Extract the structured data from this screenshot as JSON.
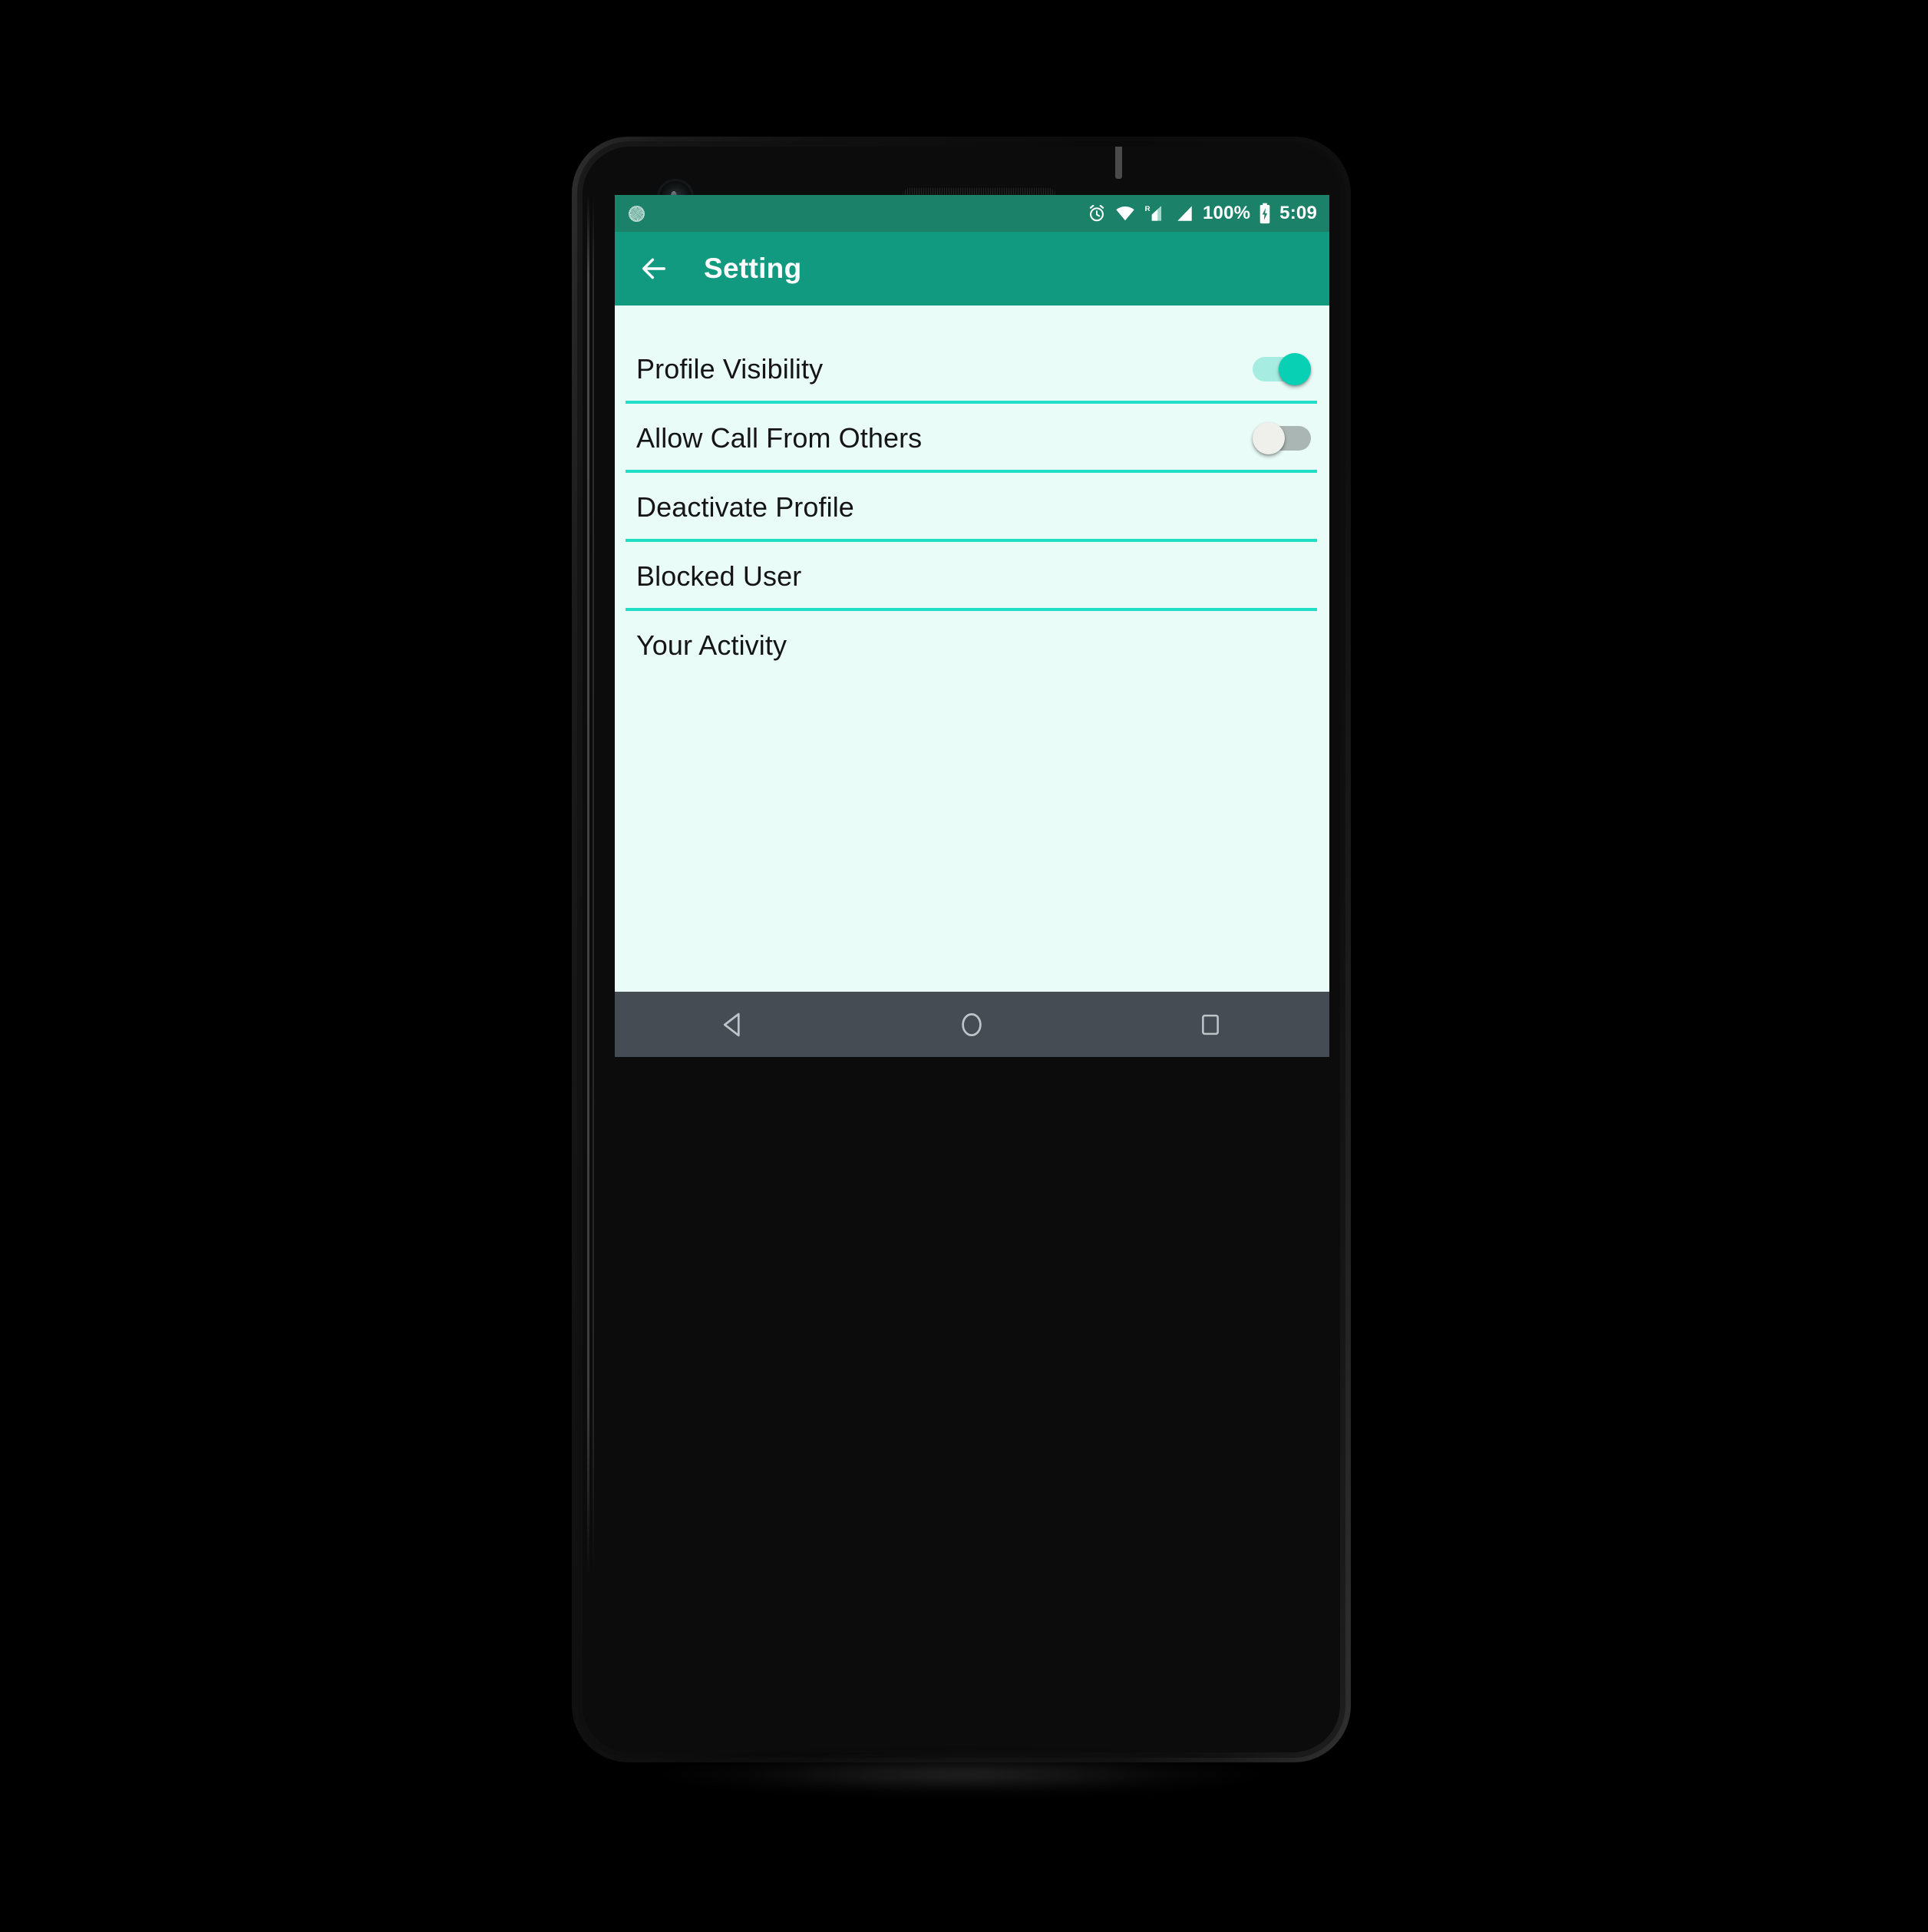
{
  "device": {
    "frame_color": "#111111",
    "hardware": {
      "front_camera": "front-camera",
      "earpiece": "earpiece-speaker",
      "proximity_sensor": "proximity-sensor",
      "power_button": "power-button",
      "volume_button": "volume-rocker"
    }
  },
  "theme": {
    "status_bar_bg": "#1b8168",
    "toolbar_bg": "#129a80",
    "content_bg": "#eafcf8",
    "divider": "#1fe0c6",
    "accent_on": "#07d0b5",
    "accent_on_track": "#a6ece1",
    "toggle_off_track": "#a9b6b4",
    "toggle_off_thumb": "#efefec",
    "nav_bar_bg": "#454c53",
    "nav_icon": "#bfc4c8",
    "text_primary": "#151515",
    "text_on_primary": "#ffffff"
  },
  "status_bar": {
    "notification_icon": "sync-notification-icon",
    "icons": [
      "alarm-icon",
      "wifi-icon",
      "signal-roaming-icon",
      "signal-icon"
    ],
    "roaming_label": "R",
    "battery_percent": "100%",
    "battery_state": "charging",
    "time": "5:09"
  },
  "toolbar": {
    "back_icon": "back-arrow-icon",
    "title": "Setting"
  },
  "settings": {
    "rows": [
      {
        "label": "Profile Visibility",
        "control": "toggle",
        "toggle_on": true,
        "divider": true
      },
      {
        "label": "Allow Call From Others",
        "control": "toggle",
        "toggle_on": false,
        "divider": true
      },
      {
        "label": "Deactivate Profile",
        "control": "none",
        "toggle_on": null,
        "divider": true
      },
      {
        "label": "Blocked User",
        "control": "none",
        "toggle_on": null,
        "divider": true
      },
      {
        "label": "Your Activity",
        "control": "none",
        "toggle_on": null,
        "divider": false
      }
    ]
  },
  "nav_bar": {
    "back": "back-triangle-icon",
    "home": "home-circle-icon",
    "recents": "recents-square-icon"
  }
}
